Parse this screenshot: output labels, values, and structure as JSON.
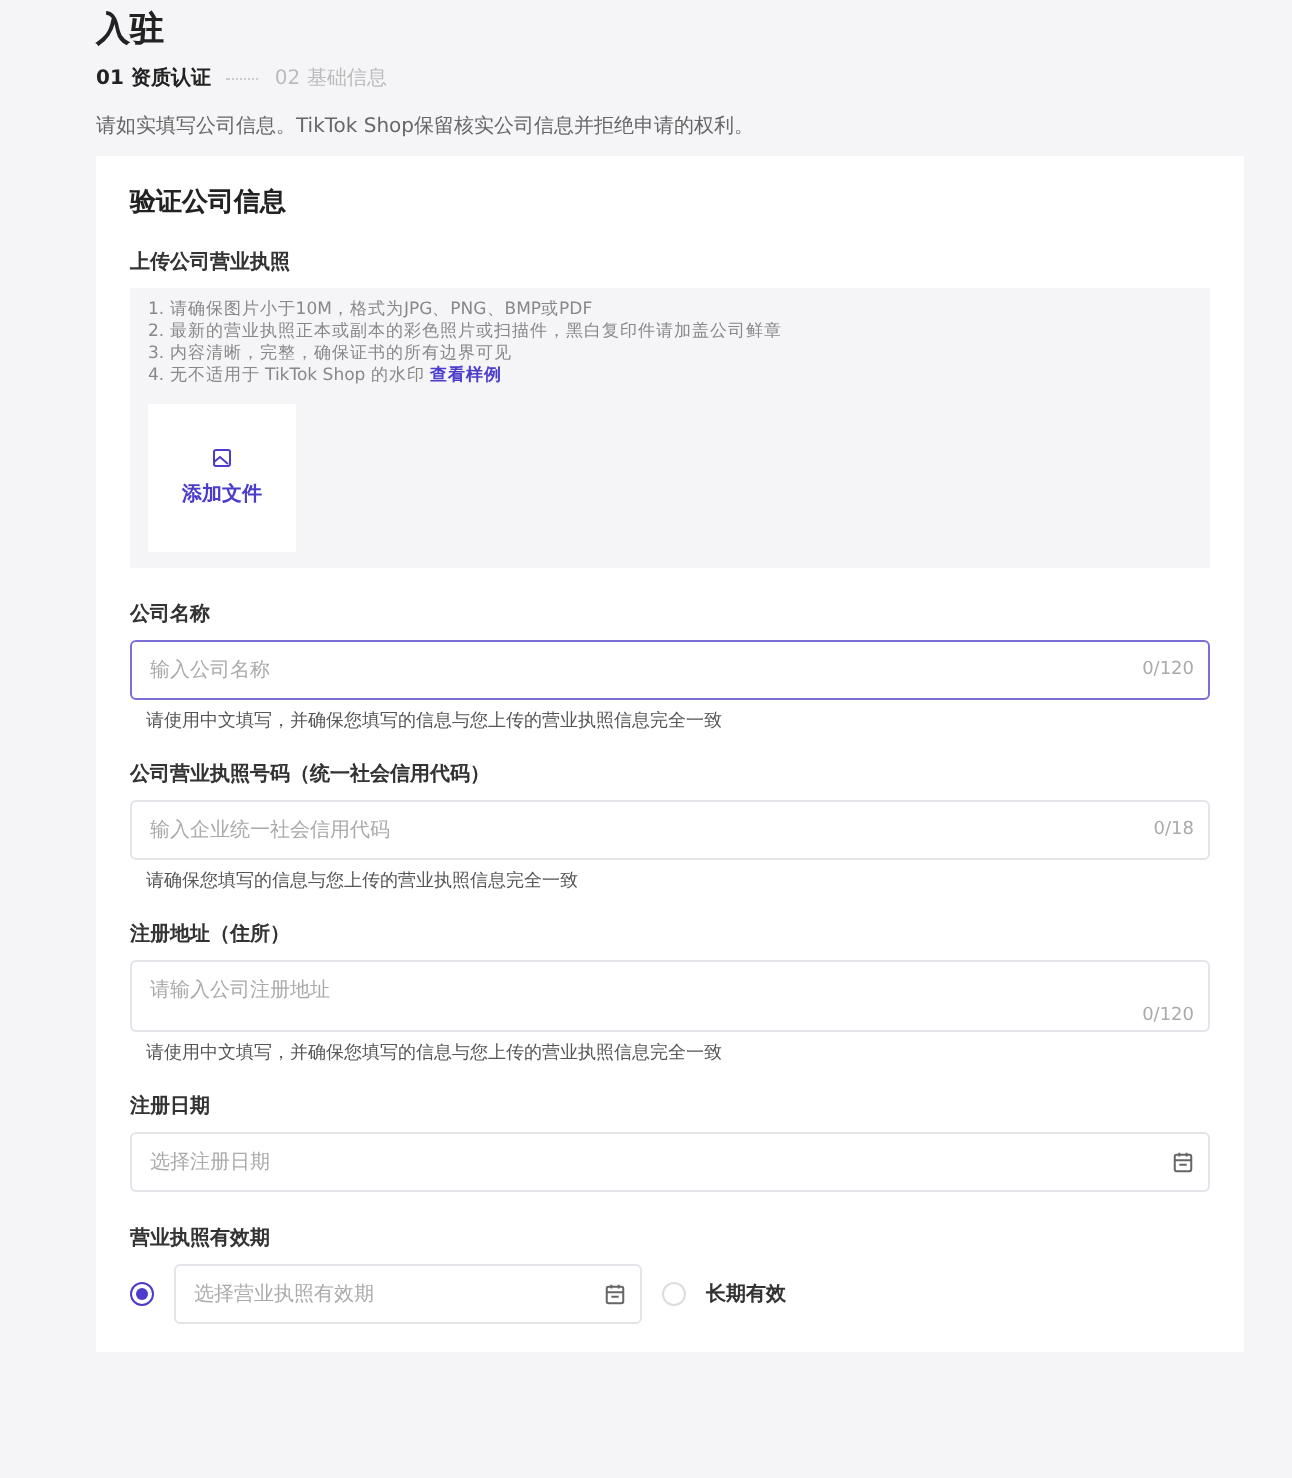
{
  "page": {
    "title": "入驻",
    "steps": [
      {
        "label": "01 资质认证",
        "selected": true
      },
      {
        "label": "02 基础信息",
        "selected": false
      }
    ],
    "description": "请如实填写公司信息。TikTok Shop保留核实公司信息并拒绝申请的权利。"
  },
  "card": {
    "title": "验证公司信息",
    "upload": {
      "label": "上传公司营业执照",
      "rules": [
        "1. 请确保图片小于10M，格式为JPG、PNG、BMP或PDF",
        "2. 最新的营业执照正本或副本的彩色照片或扫描件，黑白复印件请加盖公司鲜章",
        "3. 内容清晰，完整，确保证书的所有边界可见",
        "4. 无不适用于 TikTok Shop 的水印"
      ],
      "sample_link": "查看样例",
      "button": "添加文件"
    },
    "fields": [
      {
        "kind": "input",
        "label": "公司名称",
        "placeholder": "输入公司名称",
        "counter": "0/120",
        "focused": true,
        "helper": "请使用中文填写，并确保您填写的信息与您上传的营业执照信息完全一致"
      },
      {
        "kind": "input",
        "label": "公司营业执照号码（统一社会信用代码）",
        "placeholder": "输入企业统一社会信用代码",
        "counter": "0/18",
        "focused": false,
        "helper": "请确保您填写的信息与您上传的营业执照信息完全一致"
      },
      {
        "kind": "textarea",
        "label": "注册地址（住所）",
        "placeholder": "请输入公司注册地址",
        "counter": "0/120",
        "focused": false,
        "helper": "请使用中文填写，并确保您填写的信息与您上传的营业执照信息完全一致"
      },
      {
        "kind": "date",
        "label": "注册日期",
        "placeholder": "选择注册日期",
        "focused": false
      }
    ],
    "validity": {
      "label": "营业执照有效期",
      "options": [
        {
          "kind": "date",
          "placeholder": "选择营业执照有效期",
          "selected": true
        },
        {
          "kind": "text",
          "label": "长期有效",
          "selected": false
        }
      ]
    }
  }
}
